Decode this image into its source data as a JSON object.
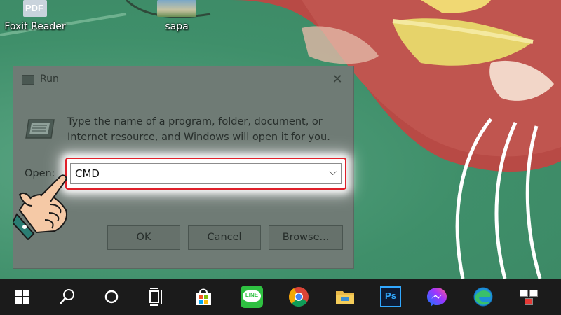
{
  "desktop": {
    "icons": [
      {
        "label": "Foxit Reader",
        "icon": "foxit-pdf-icon",
        "badge": "PDF"
      },
      {
        "label": "sapa",
        "icon": "image-thumbnail-icon"
      }
    ]
  },
  "run_dialog": {
    "title": "Run",
    "close_glyph": "✕",
    "description": "Type the name of a program, folder, document, or Internet resource, and Windows will open it for you.",
    "open_label": "Open:",
    "open_value": "CMD",
    "buttons": {
      "ok": "OK",
      "cancel": "Cancel",
      "browse": "Browse..."
    }
  },
  "highlight_color": "#e0202a",
  "taskbar": {
    "items": [
      "windows-start-icon",
      "search-icon",
      "cortana-icon",
      "task-view-icon",
      "microsoft-store-icon",
      "line-app-icon",
      "chrome-icon",
      "file-explorer-icon",
      "photoshop-icon",
      "messenger-icon",
      "edge-icon",
      "unikey-icon"
    ],
    "labels": {
      "line": "LINE",
      "photoshop": "Ps"
    }
  }
}
